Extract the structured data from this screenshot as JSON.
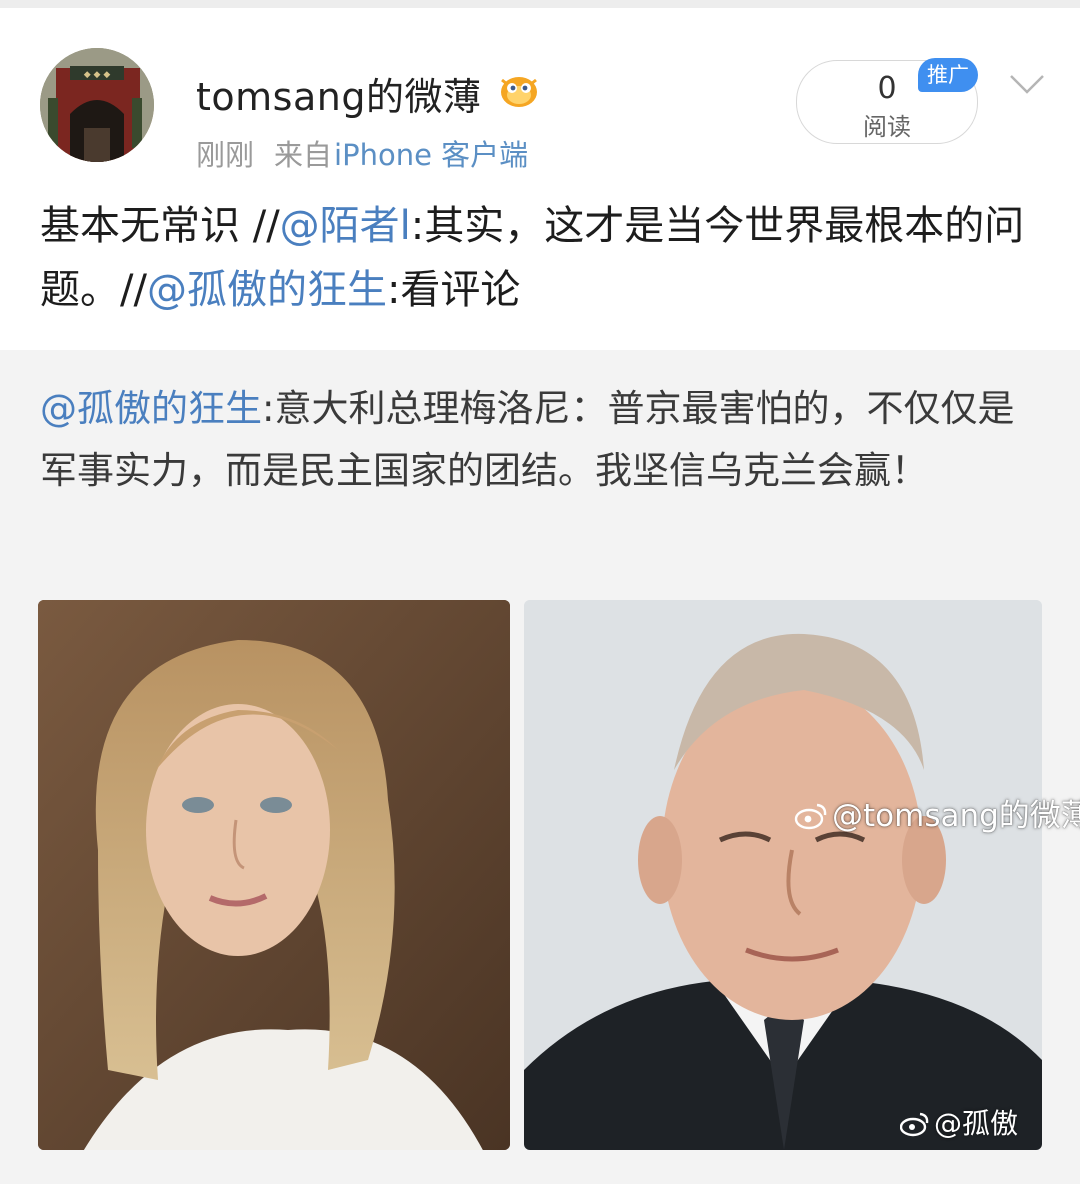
{
  "post": {
    "username": "tomsang的微薄",
    "time": "刚刚",
    "source_prefix": "来自",
    "source": "iPhone 客户端",
    "read_count": "0",
    "read_label": "阅读",
    "promo_tag": "推广",
    "text": {
      "part1": "基本无常识 //",
      "mention1": "@陌者l",
      "part2": ":其实，这才是当今世界最根本的问题。//",
      "mention2": "@孤傲的狂生",
      "part3": ":看评论"
    }
  },
  "repost": {
    "mention": "@孤傲的狂生",
    "text": ":意大利总理梅洛尼：普京最害怕的，不仅仅是军事实力，而是民主国家的团结。我坚信乌克兰会赢！"
  },
  "watermarks": {
    "inner": "@孤傲",
    "outer": "@tomsang的微薄"
  },
  "icons": {
    "verified_badge": "fish-badge-icon",
    "menu": "chevron-down-icon",
    "watermark": "weibo-logo-icon"
  },
  "colors": {
    "link": "#4a7fbf",
    "source": "#5b8fc4",
    "promo": "#3f8ff0",
    "repost_bg": "#f3f3f3"
  }
}
